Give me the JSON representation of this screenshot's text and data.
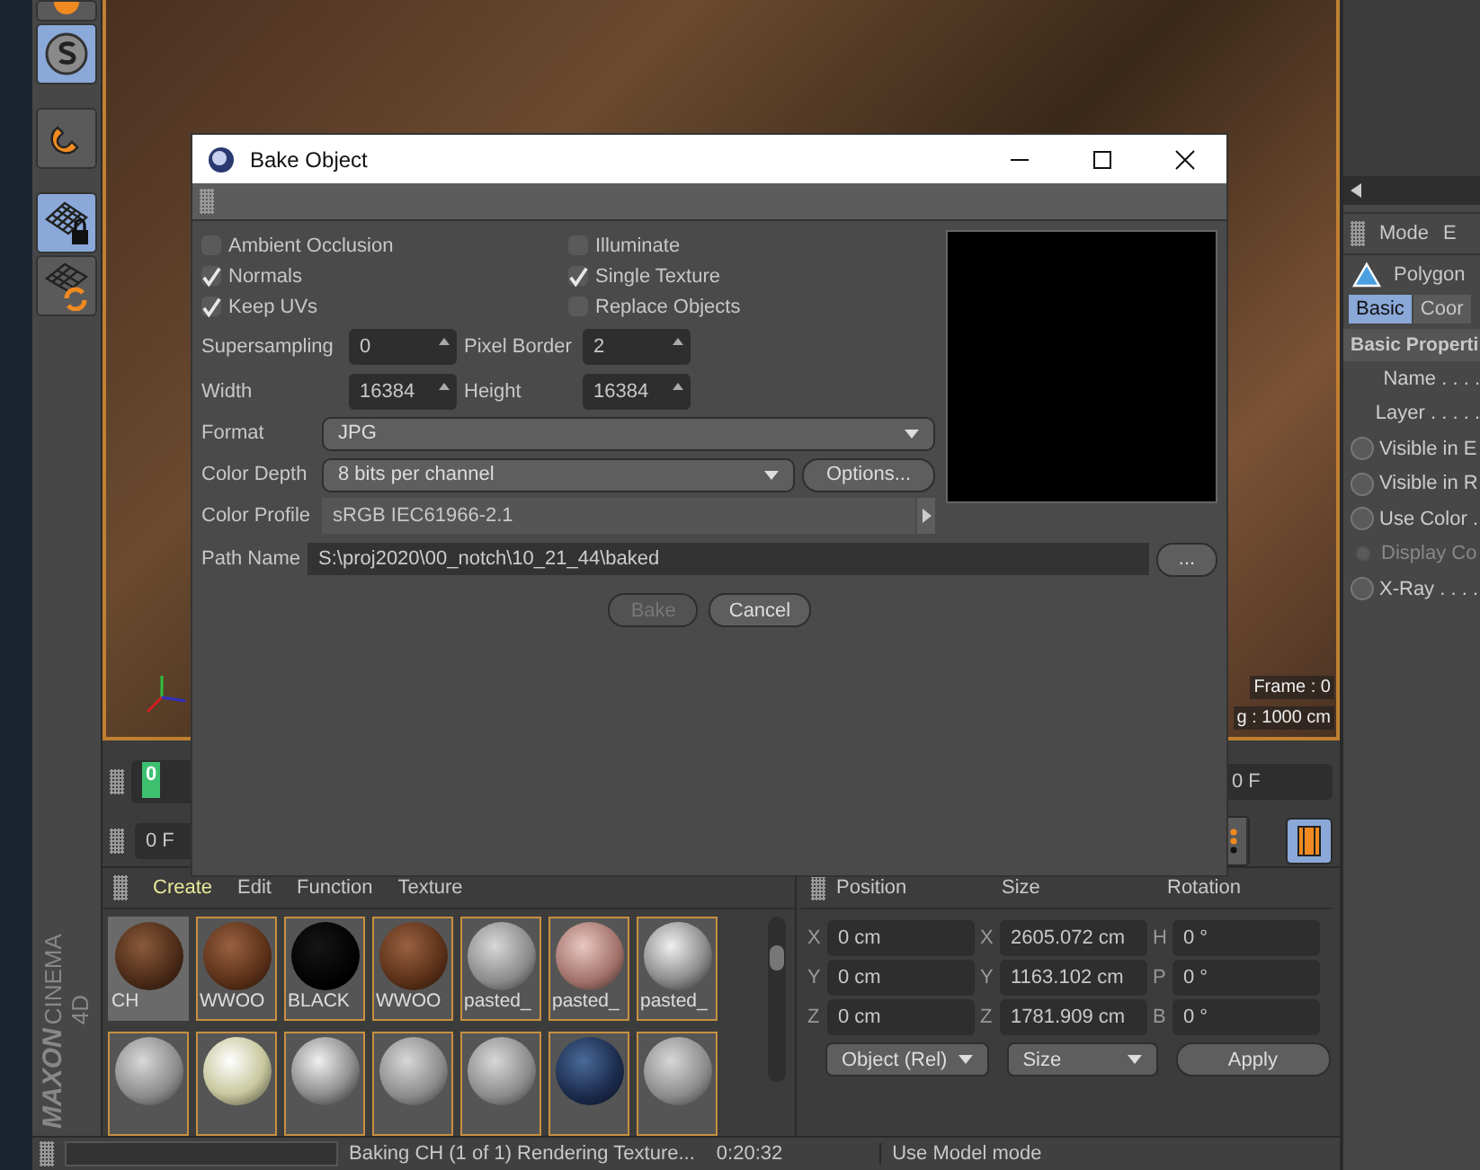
{
  "viewport": {
    "overlay": [
      "Frame : 0",
      "g : 1000 cm"
    ]
  },
  "timeline": {
    "marker": "0",
    "end_field": "0 F"
  },
  "transport": {
    "start_field": "0 F"
  },
  "brand": {
    "maker": "MAXON",
    "product": "CINEMA 4D"
  },
  "material_manager": {
    "menu": [
      {
        "label": "Create",
        "selected": true
      },
      {
        "label": "Edit",
        "selected": false
      },
      {
        "label": "Function",
        "selected": false
      },
      {
        "label": "Texture",
        "selected": false
      }
    ],
    "materials": [
      {
        "name": "CH",
        "kind": "gravel",
        "selected": true
      },
      {
        "name": "WWOO",
        "kind": "wood",
        "selected": false
      },
      {
        "name": "BLACK",
        "kind": "black",
        "selected": false
      },
      {
        "name": "WWOO",
        "kind": "wood",
        "selected": false
      },
      {
        "name": "pasted_",
        "kind": "grey",
        "selected": false
      },
      {
        "name": "pasted_",
        "kind": "pink",
        "selected": false
      },
      {
        "name": "pasted_",
        "kind": "chrome",
        "selected": false
      },
      {
        "kind": "grey",
        "selected": false
      },
      {
        "kind": "cream",
        "selected": false
      },
      {
        "kind": "chrome",
        "selected": false
      },
      {
        "kind": "grey",
        "selected": false
      },
      {
        "kind": "grey",
        "selected": false
      },
      {
        "kind": "blue",
        "selected": false
      },
      {
        "kind": "grey",
        "selected": false
      }
    ]
  },
  "coordinates": {
    "columns": [
      "Position",
      "Size",
      "Rotation"
    ],
    "rows": [
      {
        "axis": "X",
        "position": "0 cm",
        "size_axis": "X",
        "size": "2605.072 cm",
        "rot_axis": "H",
        "rotation": "0 °"
      },
      {
        "axis": "Y",
        "position": "0 cm",
        "size_axis": "Y",
        "size": "1163.102 cm",
        "rot_axis": "P",
        "rotation": "0 °"
      },
      {
        "axis": "Z",
        "position": "0 cm",
        "size_axis": "Z",
        "size": "1781.909 cm",
        "rot_axis": "B",
        "rotation": "0 °"
      }
    ],
    "mode_dropdown": "Object (Rel)",
    "size_dropdown": "Size",
    "apply": "Apply"
  },
  "attributes": {
    "menu": [
      "Mode",
      "E"
    ],
    "object": "Polygon",
    "tabs": [
      {
        "label": "Basic",
        "selected": true
      },
      {
        "label": "Coor",
        "selected": false
      }
    ],
    "section": "Basic Properti",
    "fields": [
      {
        "label": "Name . . . .",
        "kind": "plain",
        "disabled": false
      },
      {
        "label": "Layer . . . . .",
        "kind": "plain",
        "disabled": false
      },
      {
        "label": "Visible in E",
        "kind": "radio",
        "disabled": false
      },
      {
        "label": "Visible in R",
        "kind": "radio",
        "disabled": false
      },
      {
        "label": "Use Color .",
        "kind": "radio",
        "disabled": false
      },
      {
        "label": "Display Co",
        "kind": "radio",
        "disabled": true
      },
      {
        "label": "X-Ray . . . .",
        "kind": "radio",
        "disabled": false
      }
    ]
  },
  "status_bar": {
    "progress": {
      "level": 0
    },
    "message": "Baking CH (1 of 1) Rendering Texture...",
    "time": "0:20:32",
    "hint": "Use Model mode"
  },
  "dialog": {
    "title": "Bake Object",
    "options": [
      {
        "label": "Ambient Occlusion",
        "checked": false
      },
      {
        "label": "Illuminate",
        "checked": false
      },
      {
        "label": "Normals",
        "checked": true
      },
      {
        "label": "Single Texture",
        "checked": true
      },
      {
        "label": "Keep UVs",
        "checked": true
      },
      {
        "label": "Replace Objects",
        "checked": false
      }
    ],
    "numeric_fields": [
      {
        "label": "Supersampling",
        "value": "0"
      },
      {
        "label": "Pixel Border",
        "value": "2"
      },
      {
        "label": "Width",
        "value": "16384"
      },
      {
        "label": "Height",
        "value": "16384"
      }
    ],
    "format": {
      "label": "Format",
      "value": "JPG"
    },
    "color_depth": {
      "label": "Color Depth",
      "value": "8 bits per channel",
      "button": "Options..."
    },
    "color_profile": {
      "label": "Color Profile",
      "value": "sRGB IEC61966-2.1"
    },
    "path": {
      "label": "Path Name",
      "value": "S:\\proj2020\\00_notch\\10_21_44\\baked",
      "button": "..."
    },
    "buttons": [
      {
        "label": "Bake",
        "disabled": true
      },
      {
        "label": "Cancel",
        "disabled": false
      }
    ]
  }
}
